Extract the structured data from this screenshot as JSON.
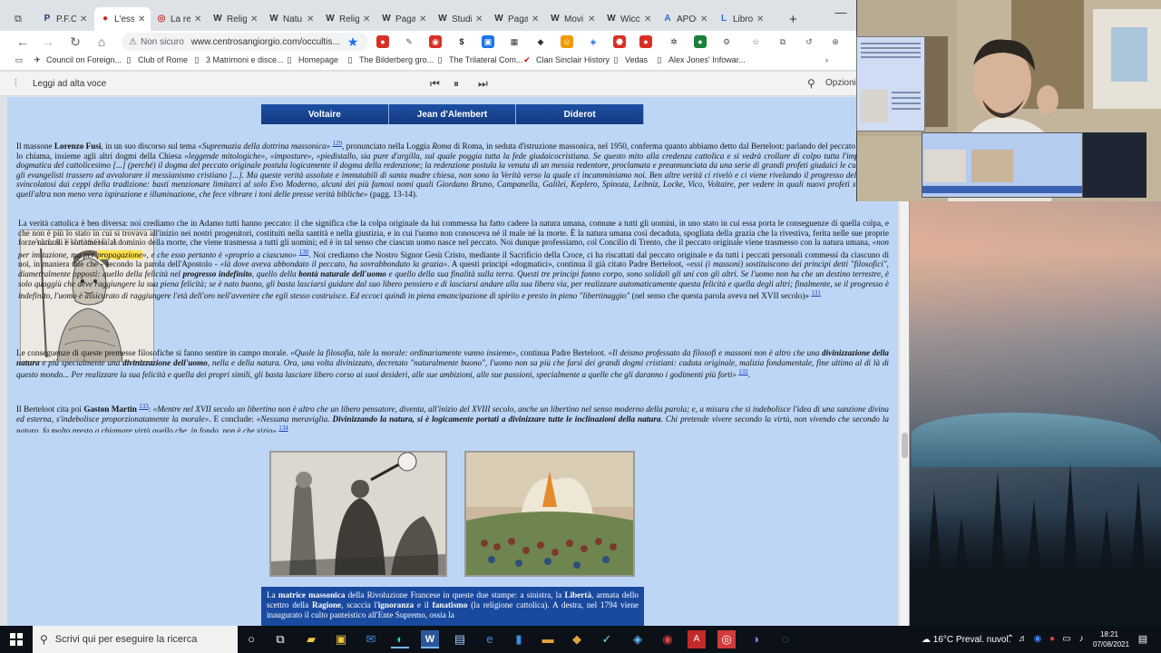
{
  "browser": {
    "tabs": [
      {
        "label": "P.F.C",
        "favicon": "P"
      },
      {
        "label": "L'esse",
        "favicon": "●",
        "active": true
      },
      {
        "label": "La rel",
        "favicon": "◎"
      },
      {
        "label": "Religi",
        "favicon": "W"
      },
      {
        "label": "Natu",
        "favicon": "W"
      },
      {
        "label": "Religi",
        "favicon": "W"
      },
      {
        "label": "Paga",
        "favicon": "W"
      },
      {
        "label": "Studi",
        "favicon": "W"
      },
      {
        "label": "Paga",
        "favicon": "W"
      },
      {
        "label": "Movi",
        "favicon": "W"
      },
      {
        "label": "Wicc",
        "favicon": "W"
      },
      {
        "label": "APOC",
        "favicon": "A"
      },
      {
        "label": "Libro",
        "favicon": "L"
      }
    ],
    "new_tab": "+",
    "window_controls": {
      "minimize": "—",
      "maximize": "☐",
      "close": "✕"
    },
    "address": {
      "security": "Non sicuro",
      "url": "www.centrosangiorgio.com/occultis..."
    },
    "bookmarks": [
      {
        "label": "Council on Foreign...",
        "icon": "globe-icon"
      },
      {
        "label": "Club of Rome",
        "icon": "doc-icon"
      },
      {
        "label": "3 Matrimoni e disce...",
        "icon": "doc-icon"
      },
      {
        "label": "Homepage",
        "icon": "doc-icon"
      },
      {
        "label": "The Bilderberg gro...",
        "icon": "doc-icon"
      },
      {
        "label": "The Trilateral Com...",
        "icon": "doc-icon"
      },
      {
        "label": "Clan Sinclair History",
        "icon": "check-icon"
      },
      {
        "label": "Vedas",
        "icon": "doc-icon"
      },
      {
        "label": "Alex Jones' Infowar...",
        "icon": "doc-icon"
      }
    ],
    "readaloud": {
      "label": "Leggi ad alta voce",
      "options": "Opzioni"
    }
  },
  "page": {
    "name_tabs": [
      "Voltaire",
      "Jean d'Alembert",
      "Diderot"
    ],
    "p1_html": "Il massone <b>Lorenzo Fusi</b>, in un suo discorso sul tema <i>«Supremazia della dottrina massonica»</i> <span class='fn'>129</span>, pronunciato nella Loggia <i>Roma</i> di Roma, in seduta d'istruzione massonica, nel 1950, conferma quanto abbiamo detto dal Berteloot: parlando del peccato originale lo chiama, insieme agli altri dogmi della Chiesa <i>«leggende mitologiche», «imposture», «piedistallo, sia pure d'argilla, sul quale poggia tutta la fede giudaicocristiana. Se questo mito alla credenza cattolica e si vedrà crollare di colpo tutta l'impalcatura dogmatica del cattolicesimo [...] (perché) il dogma del peccato originale postula logicamente il dogma della redenzione; la redenzione postula la venuta di un messia redentore, proclamata e preannunciata da una serie di grandi profeti giudaici le cui profezie gli evangelisti trassero ad avvalorare il messianismo cristiano [...]. Ma queste verità assolute e immutabili di santa madre chiesa, non sono la Verità verso la quale ci incamminiamo noi. Ben altre verità ci rivelò e ci viene rivelando il progresso del pensiero svincolatosi dai ceppi della tradizione: basti menzionare limitarci al solo Evo Moderno, alcuni dei più famosi nomi quali Giordano Bruno, Campanella, Galilei, Keplero, Spinoza, Leibniz, Locke, Vico, Voltaire, per vedere in quali nuovi profeti si proietto quell'altra non meno vera ispirazione e illuminazione, che fece vibrare i toni delle presse verità bibliche»</i> (pagg. 13-14).",
    "p2_html": "La verità cattolica è ben diversa: noi crediamo che in Adamo tutti hanno peccato: il che significa che la colpa originale da lui commessa ha fatto cadere la natura umana, comune a tutti gli uomini, in uno stato in cui essa porta le conseguenze di quella colpa, e che non è più lo stato in cui si trovava all'inizio nei nostri progenitori, costituiti nella santità e nella giustizia, e in cui l'uomo non conosceva né il male né la morte. È la natura umana così decaduta, spogliata della grazia che la rivestiva, ferita nelle sue proprie forze naturali e sottomessa al dominio della morte, che viene trasmessa a tutti gli uomini; ed è in tal senso che ciascun uomo nasce nel peccato. Noi dunque professiamo, col Concilio di Trento, che il peccato originale viene trasmesso con la natura umana, <i>«non per imitazione, ma per <span class='hl'>propagazione</span>», e che esso pertanto è «proprio a ciascuno»</i> <span class='fn'>130</span>. Noi crediamo che Nostro Signor Gesù Cristo, mediante il Sacrificio della Croce, ci ha riscattati dal peccato originale e da tutti i peccati personali commessi da ciascuno di noi, in maniera tale che - secondo la parola dell'Apostolo - <i>«là dove aveva abbondato il peccato, ha sovrabbondato la grazia»</i>. A questi principi «dogmatici», continua il già citato Padre Berteloot, <i>«essi (i massoni) sostituiscono dei principi detti \"filosofici\", diametralmente opposti: quello della felicità nel <b>progresso indefinito</b>, quello della <b>bontà naturale dell'uomo</b> e quello della sua finalità sulla terra. Questi tre principi fanno corpo, sono solidali gli uni con gli altri. Se l'uomo non ha che un destino terrestre, è solo quaggiù che deve raggiungere la sua piena felicità; se è nato buono, gli basta lasciarsi guidare dal suo libero pensiero e di lasciarsi andare alla sua libera via, per realizzare automaticamente questa felicità e quella degli altri; finalmente, se il progresso è indefinito, l'uomo è assicurato di raggiungere l'età dell'oro nell'avvenire che egli stesso costruisce. Ed eccoci quindi in piena emancipazione di spirito e presto in pieno \"libertinaggio\"</i> (nel senso che questa parola aveva nel XVII secolo)» <span class='fn'>131</span>",
    "p3_html": "Le conseguenze di queste premesse filosofiche si fanno sentire in campo morale. <i>«Quale la filosofia, tale la morale: ordinariamente vanno insieme»</i>, continua Padre Berteloot. <i>«Il deismo professato da filosofi e massoni non è altro che una <b>divinizzazione della natura</b> e più specialmente una <b>divinizzazione dell'uomo</b>, nella e della natura. Ora, una volta divinizzato, decretato \"naturalmente buono\", l'uomo non sa più che farsi dei grandi dogmi cristiani: caduta originale, malizia fondamentale, fine ultimo al di là di questo mondo... Per realizzare la sua felicità e quella dei propri simili, gli basta lasciare libero corso ai suoi desideri, alle sue ambizioni, alle sue passioni, specialmente a quelle che gli daranno i godimenti più forti»</i> <span class='fn'>132</span>.",
    "p4_html": "Il Berteloot cita poi <b>Gaston Martin</b> <span class='fn'>133</span>: <i>«Mentre nel XVII secolo un libertino non è altro che un libero pensatore, diventa, all'inizio del XVIII secolo, anche un libertino nel senso moderno della parola; e, a misura che si indebolisce l'idea di una sanzione divina ed esterna, s'indebolisce proporzionatamente la morale»</i>. E conclude: <i>«Nessuna meraviglia. <b>Divinizzando la natura, si è logicamente portati a divinizzare tutte le inclinazioni della natura</b>. Chi pretende vivere secondo la virtù, non vivendo che secondo la natura, fa molto presto a chiamare virtù quello che, in fondo, non è che vizio»</i> <span class='fn'>134</span>.",
    "caption_html": "La <b>matrice massonica</b> della Rivoluzione Francese in queste due stampe: a sinistra, la <b>Libertà</b>, armata dello scettro della <b>Ragione</b>, scaccia l'<b>ignoranza</b> e il <b>fanatismo</b> (la religione cattolica). A destra, nel 1794 viene inaugurato il culto panteistico all'Ente Supremo, ossia la",
    "portrait_inscription": "ALLA FILOSOFIA"
  },
  "taskbar": {
    "search_placeholder": "Scrivi qui per eseguire la ricerca",
    "weather": "16°C Preval. nuvol.",
    "time": "18:21",
    "date": "07/08/2021"
  }
}
